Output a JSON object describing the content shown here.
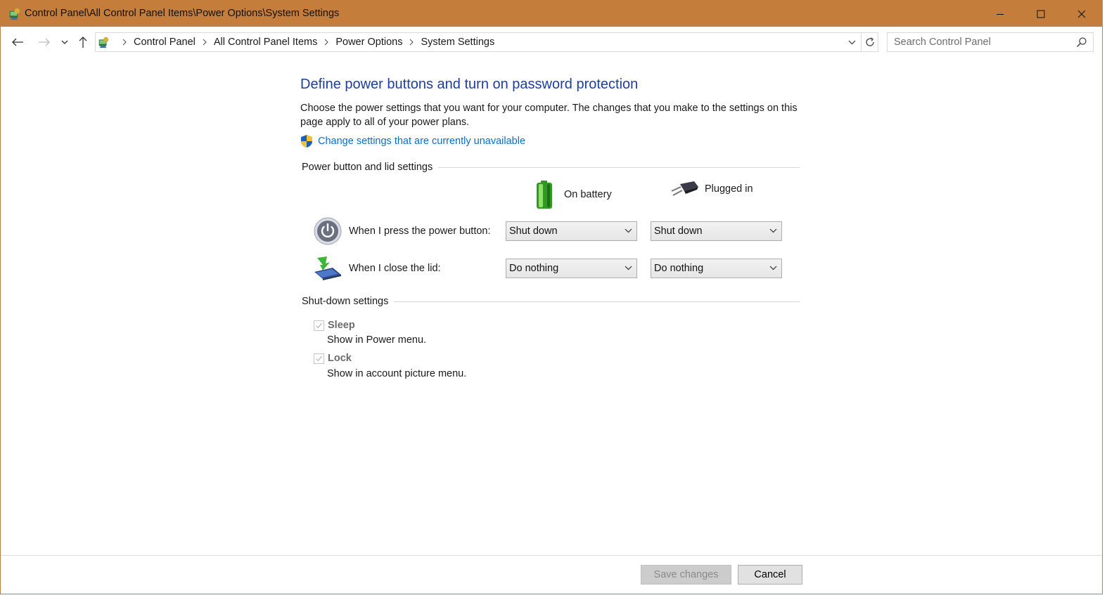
{
  "window": {
    "title": "Control Panel\\All Control Panel Items\\Power Options\\System Settings",
    "title_bar_color": "#c47d3a",
    "controls": [
      "minimize-icon",
      "maximize-icon",
      "close-icon"
    ]
  },
  "nav": {
    "breadcrumbs": [
      "Control Panel",
      "All Control Panel Items",
      "Power Options",
      "System Settings"
    ],
    "search_placeholder": "Search Control Panel"
  },
  "page": {
    "title": "Define power buttons and turn on password protection",
    "description": "Choose the power settings that you want for your computer. The changes that you make to the settings on this page apply to all of your power plans.",
    "uac_link": "Change settings that are currently unavailable",
    "link_color": "#0a6ecb",
    "title_color": "#1e3e9c"
  },
  "power_section": {
    "heading": "Power button and lid settings",
    "columns": {
      "battery": "On battery",
      "plugged": "Plugged in"
    },
    "rows": [
      {
        "label": "When I press the power button:",
        "battery_value": "Shut down",
        "plugged_value": "Shut down"
      },
      {
        "label": "When I close the lid:",
        "battery_value": "Do nothing",
        "plugged_value": "Do nothing"
      }
    ]
  },
  "shutdown_section": {
    "heading": "Shut-down settings",
    "options": [
      {
        "label": "Sleep",
        "sub": "Show in Power menu.",
        "checked": true,
        "enabled": false
      },
      {
        "label": "Lock",
        "sub": "Show in account picture menu.",
        "checked": true,
        "enabled": false
      }
    ]
  },
  "footer": {
    "save_label": "Save changes",
    "cancel_label": "Cancel"
  }
}
